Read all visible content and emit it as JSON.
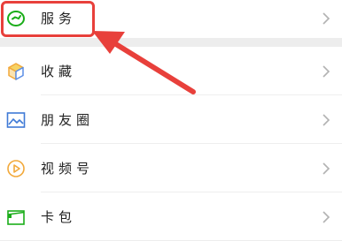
{
  "menu": {
    "items": [
      {
        "label": "服务",
        "icon": "service-icon"
      },
      {
        "label": "收藏",
        "icon": "favorites-cube-icon"
      },
      {
        "label": "朋友圈",
        "icon": "moments-picture-icon"
      },
      {
        "label": "视频号",
        "icon": "channels-play-icon"
      },
      {
        "label": "卡包",
        "icon": "card-wallet-icon"
      }
    ]
  },
  "colors": {
    "background": "#ededed",
    "row_background": "#ffffff",
    "annotation_red": "#e8403b",
    "icon_green": "#1aad19",
    "icon_orange": "#f2a93b",
    "icon_blue": "#3f7ad6"
  }
}
